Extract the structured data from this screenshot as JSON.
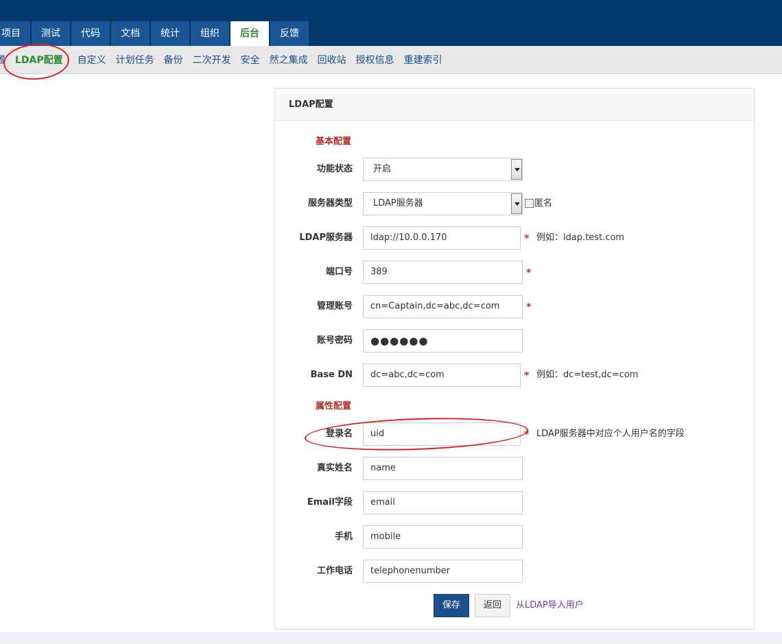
{
  "main_nav": {
    "tabs": [
      {
        "label": "项目"
      },
      {
        "label": "测试"
      },
      {
        "label": "代码"
      },
      {
        "label": "文档"
      },
      {
        "label": "统计"
      },
      {
        "label": "组织"
      },
      {
        "label": "后台",
        "active": true
      },
      {
        "label": "反馈"
      }
    ]
  },
  "sub_nav": {
    "cut_item": "置",
    "items": [
      {
        "label": "LDAP配置",
        "active": true
      },
      {
        "label": "自定义"
      },
      {
        "label": "计划任务"
      },
      {
        "label": "备份"
      },
      {
        "label": "二次开发"
      },
      {
        "label": "安全"
      },
      {
        "label": "然之集成"
      },
      {
        "label": "回收站"
      },
      {
        "label": "授权信息"
      },
      {
        "label": "重建索引"
      }
    ]
  },
  "panel": {
    "title": "LDAP配置",
    "section_basic": "基本配置",
    "section_attr": "属性配置",
    "status": {
      "label": "功能状态",
      "value": "开启"
    },
    "server_type": {
      "label": "服务器类型",
      "value": "LDAP服务器",
      "anonymous_label": "匿名"
    },
    "ldap_server": {
      "label": "LDAP服务器",
      "value": "ldap://10.0.0.170",
      "required": "*",
      "hint": "例如：ldap.test.com"
    },
    "port": {
      "label": "端口号",
      "value": "389",
      "required": "*"
    },
    "admin_account": {
      "label": "管理账号",
      "value": "cn=Captain,dc=abc,dc=com",
      "required": "*"
    },
    "account_password": {
      "label": "账号密码",
      "value": "●●●●●●"
    },
    "base_dn": {
      "label": "Base DN",
      "value": "dc=abc,dc=com",
      "required": "*",
      "hint": "例如：dc=test,dc=com"
    },
    "login_name": {
      "label": "登录名",
      "value": "uid",
      "required": "*",
      "hint": "LDAP服务器中对应个人用户名的字段"
    },
    "real_name": {
      "label": "真实姓名",
      "value": "name"
    },
    "email_field": {
      "label": "Email字段",
      "value": "email"
    },
    "mobile": {
      "label": "手机",
      "value": "mobile"
    },
    "work_phone": {
      "label": "工作电话",
      "value": "telephonenumber"
    },
    "save_label": "保存",
    "back_label": "返回",
    "import_label": "从LDAP导入用户"
  },
  "colors": {
    "header_bg": "#03396c",
    "tab_bg": "#1a5596",
    "active_green": "#2e8b34",
    "section_red": "#b5302e",
    "annotation_red": "#e0201e",
    "save_button_bg": "#1b4f8a",
    "link_purple": "#6b3fa0"
  }
}
